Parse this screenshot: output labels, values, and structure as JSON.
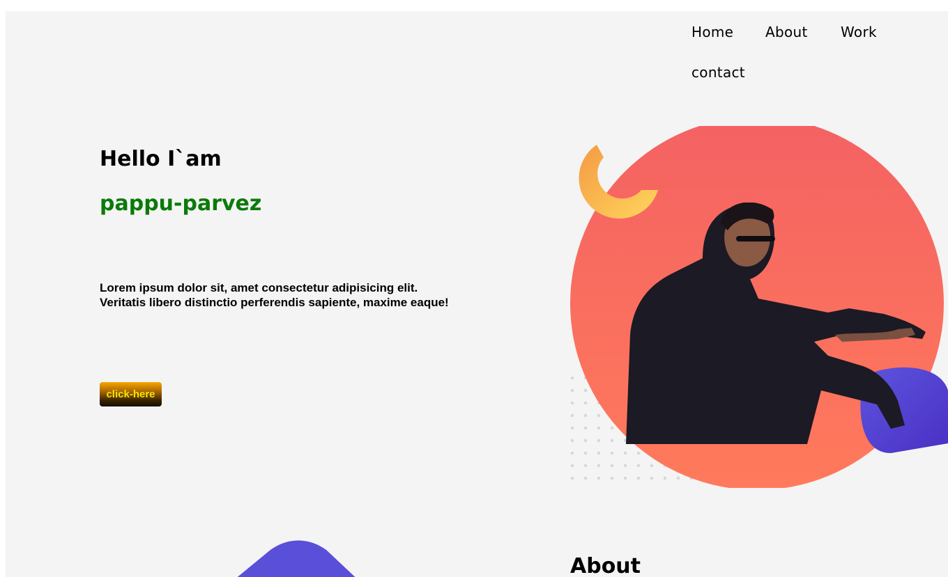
{
  "nav": {
    "items": [
      {
        "label": "Home"
      },
      {
        "label": "About"
      },
      {
        "label": "Work"
      },
      {
        "label": "contact"
      }
    ]
  },
  "hero": {
    "greeting": "Hello I`am",
    "name": "pappu-parvez",
    "intro": "Lorem ipsum dolor sit, amet consectetur adipisicing elit. Veritatis libero distinctio perferendis sapiente, maxime eaque!",
    "cta_label": "click-here"
  },
  "about": {
    "heading": "About"
  },
  "colors": {
    "name_green": "#0a7a0a",
    "circle_red": "#f56262",
    "circle_orange": "#ff7a5c",
    "blob_purple": "#5746d8",
    "ring_orange": "#f4a24a",
    "ring_yellow": "#ffd65c",
    "cta_text": "#f2e600"
  },
  "icons": {
    "portrait": "person-photo"
  }
}
